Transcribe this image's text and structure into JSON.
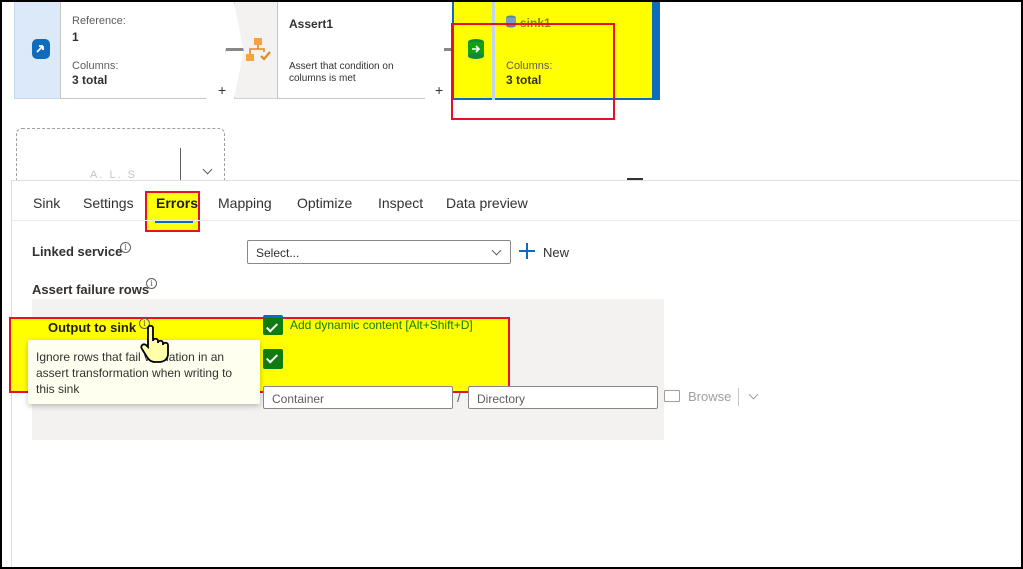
{
  "pipeline": {
    "source_node": {
      "reference_label": "Reference:",
      "reference_value": "1",
      "columns_label": "Columns:",
      "columns_value": "3 total"
    },
    "assert_node": {
      "title": "Assert1",
      "description": "Assert that condition on columns is met"
    },
    "sink_node": {
      "title": "sink1",
      "columns_label": "Columns:",
      "columns_value": "3 total"
    },
    "add_symbol": "+",
    "ghost_text": "A. L. S"
  },
  "tabs": [
    {
      "label": "Sink"
    },
    {
      "label": "Settings"
    },
    {
      "label": "Errors",
      "active": true
    },
    {
      "label": "Mapping"
    },
    {
      "label": "Optimize"
    },
    {
      "label": "Inspect"
    },
    {
      "label": "Data preview"
    }
  ],
  "errors": {
    "linked_service_label": "Linked service",
    "linked_service_value": "Select...",
    "new_label": "New",
    "assert_failure_rows_label": "Assert failure rows",
    "output_to_sink_label": "Output to sink",
    "dynamic_content_link": "Add dynamic content [Alt+Shift+D]",
    "tooltip_text": "Ignore rows that fail validation in an assert transformation when writing to this sink",
    "container_placeholder": "Container",
    "directory_placeholder": "Directory",
    "path_separator": "/",
    "browse_label": "Browse",
    "info_glyph": "i"
  },
  "colors": {
    "accent": "#0f6cbd",
    "highlight": "#ffff00",
    "annotation": "#e81123",
    "check": "#107c10"
  }
}
